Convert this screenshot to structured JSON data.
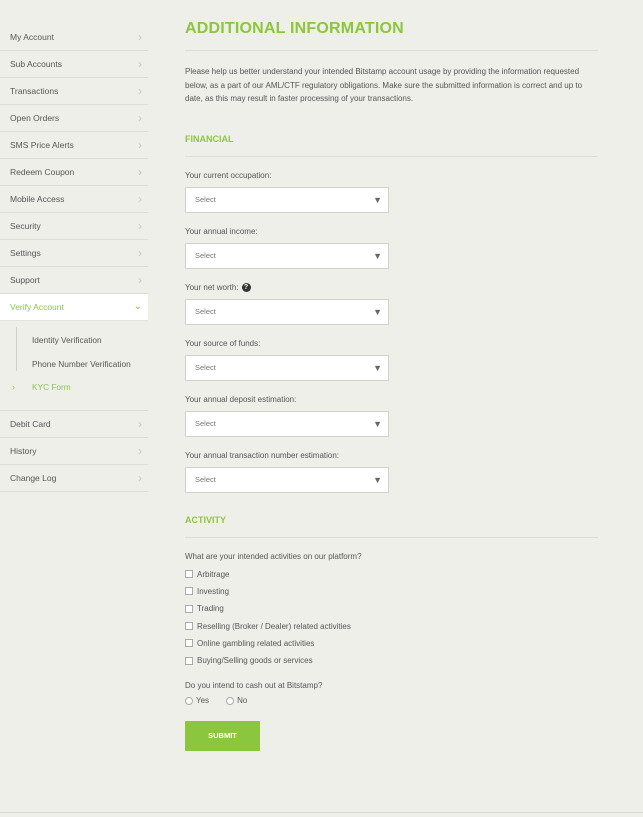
{
  "sidebar": {
    "items_top": [
      {
        "label": "My Account"
      },
      {
        "label": "Sub Accounts"
      },
      {
        "label": "Transactions"
      },
      {
        "label": "Open Orders"
      },
      {
        "label": "SMS Price Alerts"
      },
      {
        "label": "Redeem Coupon"
      },
      {
        "label": "Mobile Access"
      },
      {
        "label": "Security"
      },
      {
        "label": "Settings"
      },
      {
        "label": "Support"
      }
    ],
    "active_item": {
      "label": "Verify Account"
    },
    "sub_items": [
      {
        "label": "Identity Verification"
      },
      {
        "label": "Phone Number Verification"
      },
      {
        "label": "KYC Form"
      }
    ],
    "items_bottom": [
      {
        "label": "Debit Card"
      },
      {
        "label": "History"
      },
      {
        "label": "Change Log"
      }
    ]
  },
  "main": {
    "title": "ADDITIONAL INFORMATION",
    "intro": "Please help us better understand your intended Bitstamp account usage by providing the information requested below, as a part of our AML/CTF regulatory obligations. Make sure the submitted information is correct and up to date, as this may result in faster processing of your transactions.",
    "financial": {
      "title": "FINANCIAL",
      "fields": [
        {
          "label": "Your current occupation:",
          "value": "Select"
        },
        {
          "label": "Your annual income:",
          "value": "Select"
        },
        {
          "label": "Your net worth:",
          "value": "Select"
        },
        {
          "label": "Your source of funds:",
          "value": "Select"
        },
        {
          "label": "Your annual deposit estimation:",
          "value": "Select"
        },
        {
          "label": "Your annual transaction number estimation:",
          "value": "Select"
        }
      ]
    },
    "activity": {
      "title": "ACTIVITY",
      "question1": "What are your intended activities on our platform?",
      "options": [
        {
          "label": "Arbitrage"
        },
        {
          "label": "Investing"
        },
        {
          "label": "Trading"
        },
        {
          "label": "Reselling (Broker / Dealer) related activities"
        },
        {
          "label": "Online gambling related activities"
        },
        {
          "label": "Buying/Selling goods or services"
        }
      ],
      "question2": "Do you intend to cash out at Bitstamp?",
      "yes_label": "Yes",
      "no_label": "No"
    },
    "submit_label": "SUBMIT"
  },
  "colors": {
    "accent": "#8cc63f",
    "background": "#efefea"
  }
}
